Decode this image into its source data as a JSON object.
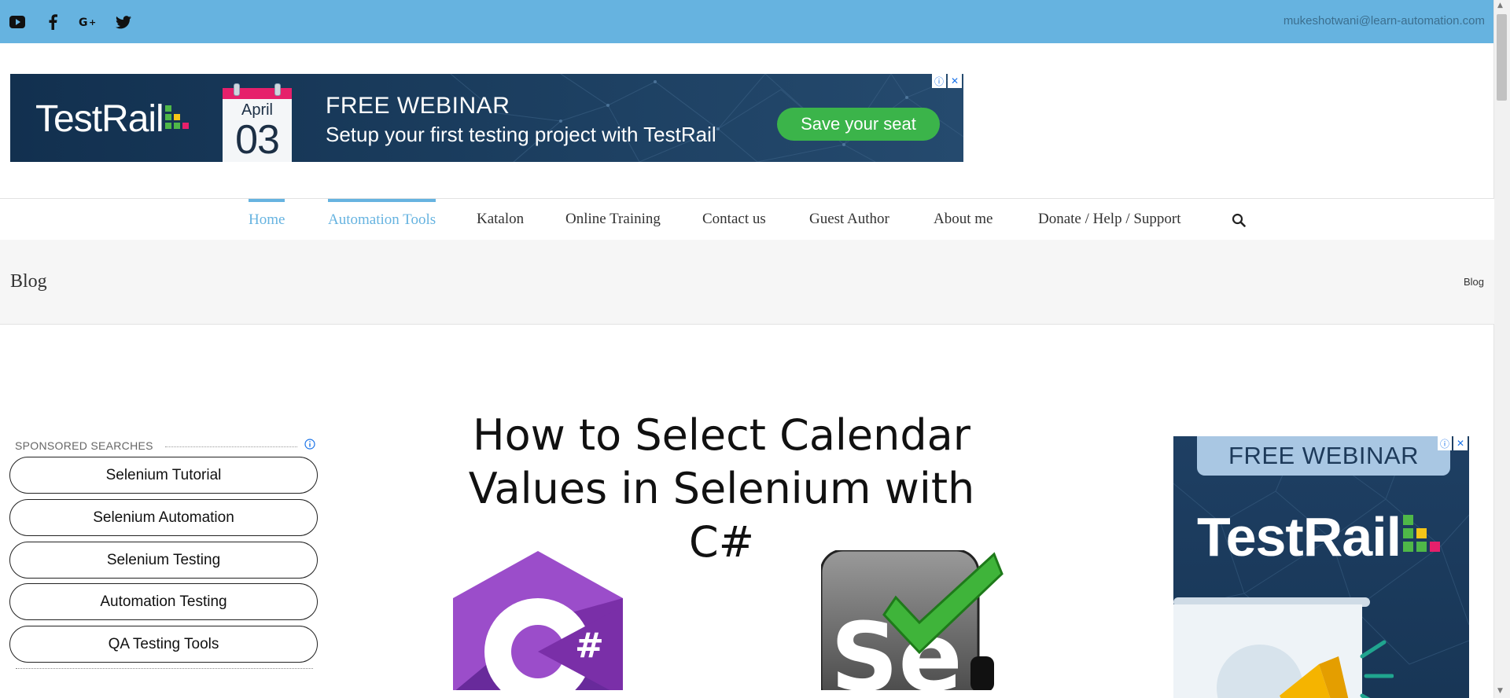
{
  "colors": {
    "topbar": "#66b3e0",
    "accent": "#66b3e0",
    "cta": "#3bb44a",
    "banner_bg": "#12304f",
    "calendar_band": "#e6206b"
  },
  "topbar": {
    "icons": [
      "youtube-icon",
      "facebook-icon",
      "google-plus-icon",
      "twitter-icon"
    ],
    "email": "mukeshotwani@learn-automation.com"
  },
  "banner_ad": {
    "brand": "TestRail",
    "calendar_month": "April",
    "calendar_day": "03",
    "headline": "FREE WEBINAR",
    "subline": "Setup your first testing project with TestRail",
    "cta": "Save your seat"
  },
  "nav": {
    "items": [
      {
        "label": "Home",
        "active": true
      },
      {
        "label": "Automation Tools",
        "active": true
      },
      {
        "label": "Katalon",
        "active": false
      },
      {
        "label": "Online Training",
        "active": false
      },
      {
        "label": "Contact us",
        "active": false
      },
      {
        "label": "Guest Author",
        "active": false
      },
      {
        "label": "About me",
        "active": false
      },
      {
        "label": "Donate / Help / Support",
        "active": false
      }
    ],
    "search_icon": "search-icon"
  },
  "page": {
    "title": "Blog",
    "breadcrumb": "Blog"
  },
  "sponsored": {
    "label": "SPONSORED SEARCHES",
    "items": [
      "Selenium Tutorial",
      "Selenium Automation",
      "Selenium Testing",
      "Automation Testing",
      "QA Testing Tools"
    ]
  },
  "feature": {
    "title_line1": "How to Select Calendar",
    "title_line2": "Values in Selenium with C#",
    "csharp_symbol": "#",
    "selenium_symbol": "Se"
  },
  "side_ad": {
    "headline": "FREE WEBINAR",
    "brand": "TestRail"
  }
}
